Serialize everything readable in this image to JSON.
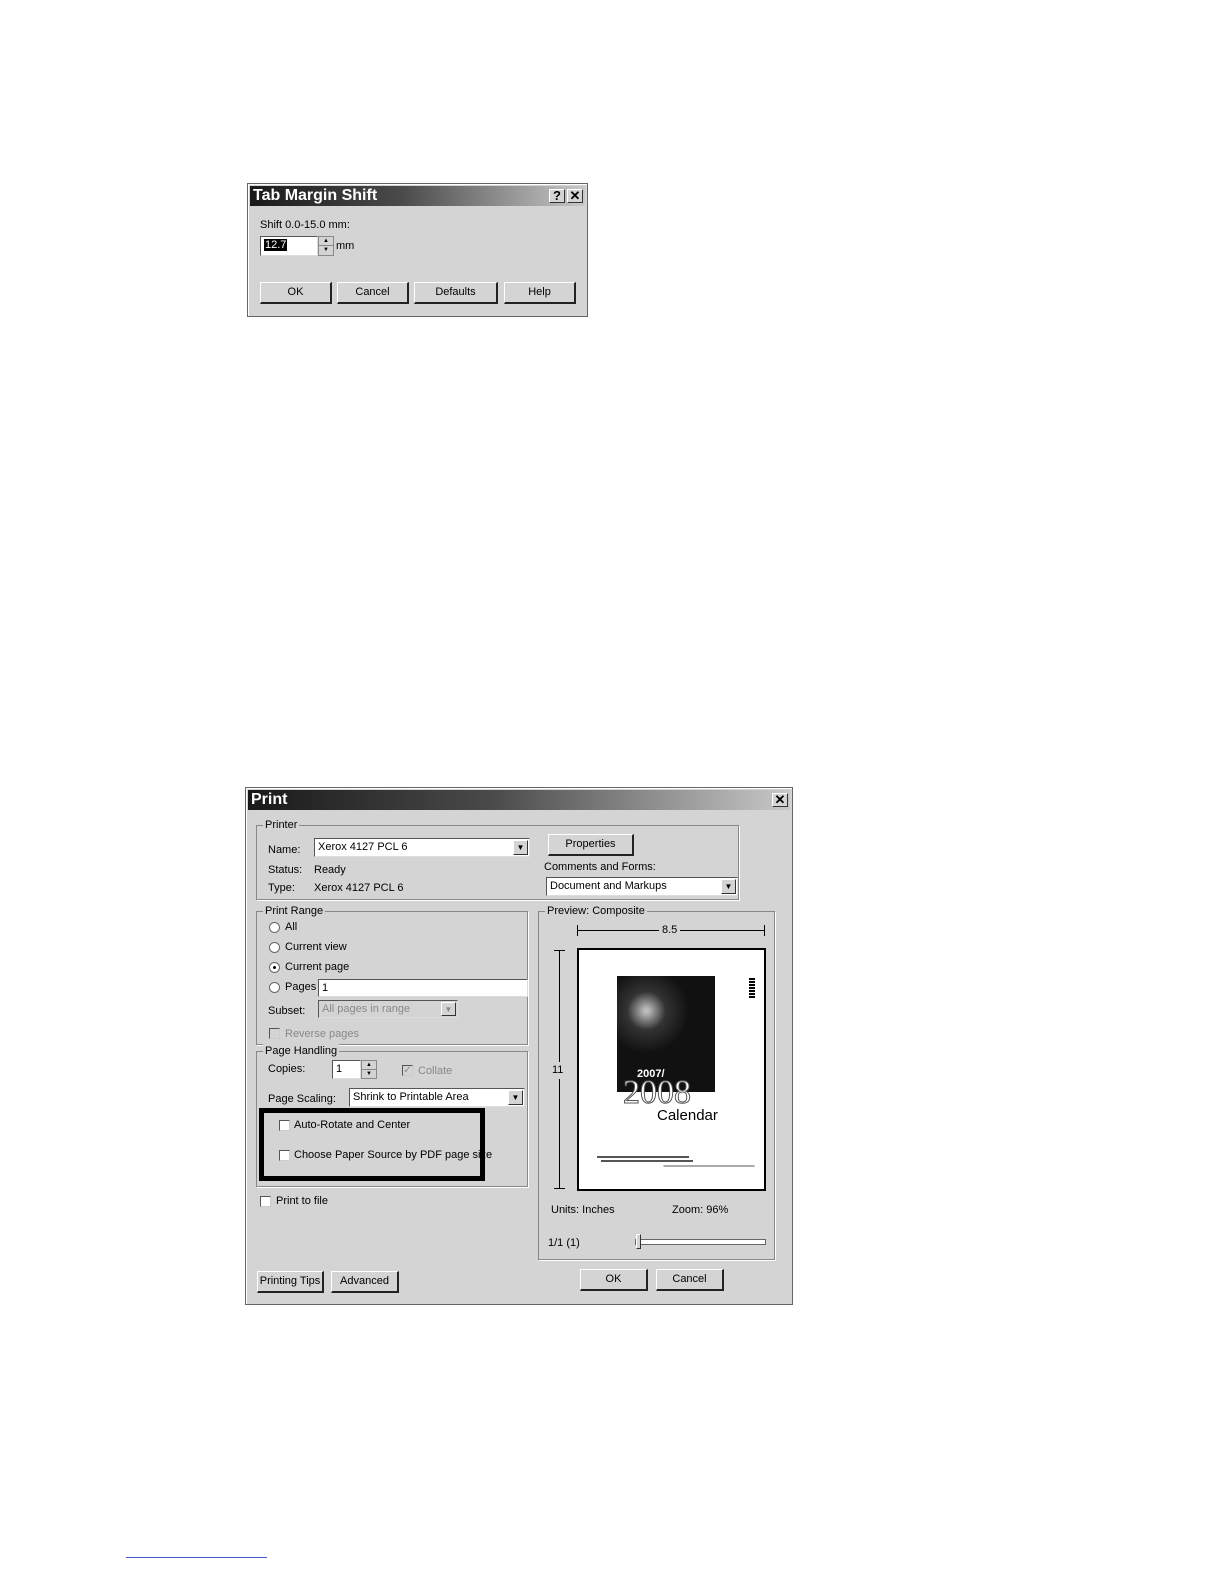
{
  "tab_margin_dialog": {
    "title": "Tab Margin Shift",
    "help_glyph": "?",
    "close_glyph": "✕",
    "shift_label": "Shift 0.0-15.0 mm:",
    "shift_value": "12.7",
    "unit": "mm",
    "buttons": {
      "ok": "OK",
      "cancel": "Cancel",
      "defaults": "Defaults",
      "help": "Help"
    }
  },
  "print_dialog": {
    "title": "Print",
    "close_glyph": "✕",
    "printer": {
      "group_title": "Printer",
      "name_label": "Name:",
      "name_value": "Xerox 4127 PCL 6",
      "status_label": "Status:",
      "status_value": "Ready",
      "type_label": "Type:",
      "type_value": "Xerox 4127 PCL 6",
      "properties_button": "Properties",
      "comments_label": "Comments and Forms:",
      "comments_value": "Document and Markups"
    },
    "print_range": {
      "group_title": "Print Range",
      "options": [
        "All",
        "Current view",
        "Current page",
        "Pages"
      ],
      "selected": "Current page",
      "pages_value": "1",
      "subset_label": "Subset:",
      "subset_value": "All pages in range",
      "reverse_pages": "Reverse pages"
    },
    "page_handling": {
      "group_title": "Page Handling",
      "copies_label": "Copies:",
      "copies_value": "1",
      "collate": "Collate",
      "scaling_label": "Page Scaling:",
      "scaling_value": "Shrink to Printable Area",
      "auto_rotate": "Auto-Rotate and Center",
      "choose_paper": "Choose Paper Source by PDF page size"
    },
    "print_to_file": "Print to file",
    "preview": {
      "group_title": "Preview: Composite",
      "width": "8.5",
      "height": "11",
      "units": "Units: Inches",
      "zoom": "Zoom:  96%",
      "page_count": "1/1 (1)",
      "calendar_year_small": "2007/",
      "calendar_year": "2008",
      "calendar_word": "Calendar"
    },
    "buttons": {
      "printing_tips": "Printing Tips",
      "advanced": "Advanced",
      "ok": "OK",
      "cancel": "Cancel"
    }
  }
}
